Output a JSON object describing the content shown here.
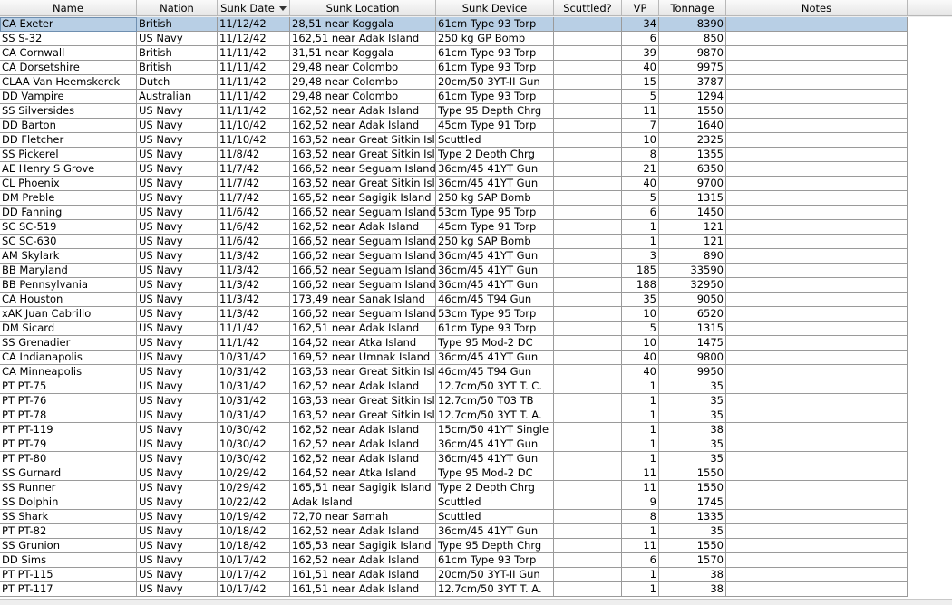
{
  "table": {
    "columns": [
      {
        "key": "name",
        "label": "Name"
      },
      {
        "key": "nation",
        "label": "Nation"
      },
      {
        "key": "date",
        "label": "Sunk Date",
        "sorted": "descending"
      },
      {
        "key": "location",
        "label": "Sunk Location"
      },
      {
        "key": "device",
        "label": "Sunk Device"
      },
      {
        "key": "scuttled",
        "label": "Scuttled?"
      },
      {
        "key": "vp",
        "label": "VP"
      },
      {
        "key": "tonnage",
        "label": "Tonnage"
      },
      {
        "key": "notes",
        "label": "Notes"
      }
    ],
    "selected_row": 0,
    "selection_color": "#b8cfe5",
    "sort_icon": "sort-descending-icon",
    "rows": [
      {
        "name": "CA Exeter",
        "nation": "British",
        "date": "11/12/42",
        "location": "28,51 near Koggala",
        "device": "61cm Type 93 Torp",
        "scuttled": "",
        "vp": "34",
        "tonnage": "8390",
        "notes": ""
      },
      {
        "name": "SS S-32",
        "nation": "US Navy",
        "date": "11/12/42",
        "location": "162,51 near Adak Island",
        "device": "250 kg GP Bomb",
        "scuttled": "",
        "vp": "6",
        "tonnage": "850",
        "notes": ""
      },
      {
        "name": "CA Cornwall",
        "nation": "British",
        "date": "11/11/42",
        "location": "31,51 near Koggala",
        "device": "61cm Type 93 Torp",
        "scuttled": "",
        "vp": "39",
        "tonnage": "9870",
        "notes": ""
      },
      {
        "name": "CA Dorsetshire",
        "nation": "British",
        "date": "11/11/42",
        "location": "29,48 near Colombo",
        "device": "61cm Type 93 Torp",
        "scuttled": "",
        "vp": "40",
        "tonnage": "9975",
        "notes": ""
      },
      {
        "name": "CLAA Van Heemskerck",
        "nation": "Dutch",
        "date": "11/11/42",
        "location": "29,48 near Colombo",
        "device": "20cm/50 3YT-II Gun",
        "scuttled": "",
        "vp": "15",
        "tonnage": "3787",
        "notes": ""
      },
      {
        "name": "DD Vampire",
        "nation": "Australian",
        "date": "11/11/42",
        "location": "29,48 near Colombo",
        "device": "61cm Type 93 Torp",
        "scuttled": "",
        "vp": "5",
        "tonnage": "1294",
        "notes": ""
      },
      {
        "name": "SS Silversides",
        "nation": "US Navy",
        "date": "11/11/42",
        "location": "162,52 near Adak Island",
        "device": "Type 95 Depth Chrg",
        "scuttled": "",
        "vp": "11",
        "tonnage": "1550",
        "notes": ""
      },
      {
        "name": "DD Barton",
        "nation": "US Navy",
        "date": "11/10/42",
        "location": "162,52 near Adak Island",
        "device": "45cm Type 91 Torp",
        "scuttled": "",
        "vp": "7",
        "tonnage": "1640",
        "notes": ""
      },
      {
        "name": "DD Fletcher",
        "nation": "US Navy",
        "date": "11/10/42",
        "location": "163,52 near Great Sitkin Isl...",
        "device": "Scuttled",
        "scuttled": "",
        "vp": "10",
        "tonnage": "2325",
        "notes": ""
      },
      {
        "name": "SS Pickerel",
        "nation": "US Navy",
        "date": "11/8/42",
        "location": "163,52 near Great Sitkin Isl...",
        "device": "Type 2 Depth Chrg",
        "scuttled": "",
        "vp": "8",
        "tonnage": "1355",
        "notes": ""
      },
      {
        "name": "AE Henry S Grove",
        "nation": "US Navy",
        "date": "11/7/42",
        "location": "166,52 near Seguam Island",
        "device": "36cm/45 41YT Gun",
        "scuttled": "",
        "vp": "21",
        "tonnage": "6350",
        "notes": ""
      },
      {
        "name": "CL Phoenix",
        "nation": "US Navy",
        "date": "11/7/42",
        "location": "163,52 near Great Sitkin Isl...",
        "device": "36cm/45 41YT Gun",
        "scuttled": "",
        "vp": "40",
        "tonnage": "9700",
        "notes": ""
      },
      {
        "name": "DM Preble",
        "nation": "US Navy",
        "date": "11/7/42",
        "location": "165,52 near Sagigik Island",
        "device": "250 kg SAP Bomb",
        "scuttled": "",
        "vp": "5",
        "tonnage": "1315",
        "notes": ""
      },
      {
        "name": "DD Fanning",
        "nation": "US Navy",
        "date": "11/6/42",
        "location": "166,52 near Seguam Island",
        "device": "53cm Type 95 Torp",
        "scuttled": "",
        "vp": "6",
        "tonnage": "1450",
        "notes": ""
      },
      {
        "name": "SC SC-519",
        "nation": "US Navy",
        "date": "11/6/42",
        "location": "162,52 near Adak Island",
        "device": "45cm Type 91 Torp",
        "scuttled": "",
        "vp": "1",
        "tonnage": "121",
        "notes": ""
      },
      {
        "name": "SC SC-630",
        "nation": "US Navy",
        "date": "11/6/42",
        "location": "166,52 near Seguam Island",
        "device": "250 kg SAP Bomb",
        "scuttled": "",
        "vp": "1",
        "tonnage": "121",
        "notes": ""
      },
      {
        "name": "AM Skylark",
        "nation": "US Navy",
        "date": "11/3/42",
        "location": "166,52 near Seguam Island",
        "device": "36cm/45 41YT Gun",
        "scuttled": "",
        "vp": "3",
        "tonnage": "890",
        "notes": ""
      },
      {
        "name": "BB Maryland",
        "nation": "US Navy",
        "date": "11/3/42",
        "location": "166,52 near Seguam Island",
        "device": "36cm/45 41YT Gun",
        "scuttled": "",
        "vp": "185",
        "tonnage": "33590",
        "notes": ""
      },
      {
        "name": "BB Pennsylvania",
        "nation": "US Navy",
        "date": "11/3/42",
        "location": "166,52 near Seguam Island",
        "device": "36cm/45 41YT Gun",
        "scuttled": "",
        "vp": "188",
        "tonnage": "32950",
        "notes": ""
      },
      {
        "name": "CA Houston",
        "nation": "US Navy",
        "date": "11/3/42",
        "location": "173,49 near Sanak Island",
        "device": "46cm/45 T94 Gun",
        "scuttled": "",
        "vp": "35",
        "tonnage": "9050",
        "notes": ""
      },
      {
        "name": "xAK Juan Cabrillo",
        "nation": "US Navy",
        "date": "11/3/42",
        "location": "166,52 near Seguam Island",
        "device": "53cm Type 95 Torp",
        "scuttled": "",
        "vp": "10",
        "tonnage": "6520",
        "notes": ""
      },
      {
        "name": "DM Sicard",
        "nation": "US Navy",
        "date": "11/1/42",
        "location": "162,51 near Adak Island",
        "device": "61cm Type 93 Torp",
        "scuttled": "",
        "vp": "5",
        "tonnage": "1315",
        "notes": ""
      },
      {
        "name": "SS Grenadier",
        "nation": "US Navy",
        "date": "11/1/42",
        "location": "164,52 near Atka Island",
        "device": "Type 95 Mod-2 DC",
        "scuttled": "",
        "vp": "10",
        "tonnage": "1475",
        "notes": ""
      },
      {
        "name": "CA Indianapolis",
        "nation": "US Navy",
        "date": "10/31/42",
        "location": "169,52 near Umnak Island",
        "device": "36cm/45 41YT Gun",
        "scuttled": "",
        "vp": "40",
        "tonnage": "9800",
        "notes": ""
      },
      {
        "name": "CA Minneapolis",
        "nation": "US Navy",
        "date": "10/31/42",
        "location": "163,53 near Great Sitkin Isl...",
        "device": "46cm/45 T94 Gun",
        "scuttled": "",
        "vp": "40",
        "tonnage": "9950",
        "notes": ""
      },
      {
        "name": "PT PT-75",
        "nation": "US Navy",
        "date": "10/31/42",
        "location": "162,52 near Adak Island",
        "device": "12.7cm/50 3YT T. C.",
        "scuttled": "",
        "vp": "1",
        "tonnage": "35",
        "notes": ""
      },
      {
        "name": "PT PT-76",
        "nation": "US Navy",
        "date": "10/31/42",
        "location": "163,53 near Great Sitkin Isl...",
        "device": "12.7cm/50 T03 TB",
        "scuttled": "",
        "vp": "1",
        "tonnage": "35",
        "notes": ""
      },
      {
        "name": "PT PT-78",
        "nation": "US Navy",
        "date": "10/31/42",
        "location": "163,52 near Great Sitkin Isl...",
        "device": "12.7cm/50 3YT T. A.",
        "scuttled": "",
        "vp": "1",
        "tonnage": "35",
        "notes": ""
      },
      {
        "name": "PT PT-119",
        "nation": "US Navy",
        "date": "10/30/42",
        "location": "162,52 near Adak Island",
        "device": "15cm/50 41YT Single",
        "scuttled": "",
        "vp": "1",
        "tonnage": "38",
        "notes": ""
      },
      {
        "name": "PT PT-79",
        "nation": "US Navy",
        "date": "10/30/42",
        "location": "162,52 near Adak Island",
        "device": "36cm/45 41YT Gun",
        "scuttled": "",
        "vp": "1",
        "tonnage": "35",
        "notes": ""
      },
      {
        "name": "PT PT-80",
        "nation": "US Navy",
        "date": "10/30/42",
        "location": "162,52 near Adak Island",
        "device": "36cm/45 41YT Gun",
        "scuttled": "",
        "vp": "1",
        "tonnage": "35",
        "notes": ""
      },
      {
        "name": "SS Gurnard",
        "nation": "US Navy",
        "date": "10/29/42",
        "location": "164,52 near Atka Island",
        "device": "Type 95 Mod-2 DC",
        "scuttled": "",
        "vp": "11",
        "tonnage": "1550",
        "notes": ""
      },
      {
        "name": "SS Runner",
        "nation": "US Navy",
        "date": "10/29/42",
        "location": "165,51 near Sagigik Island",
        "device": "Type 2 Depth Chrg",
        "scuttled": "",
        "vp": "11",
        "tonnage": "1550",
        "notes": ""
      },
      {
        "name": "SS Dolphin",
        "nation": "US Navy",
        "date": "10/22/42",
        "location": "Adak Island",
        "device": "Scuttled",
        "scuttled": "",
        "vp": "9",
        "tonnage": "1745",
        "notes": ""
      },
      {
        "name": "SS Shark",
        "nation": "US Navy",
        "date": "10/19/42",
        "location": "72,70 near Samah",
        "device": "Scuttled",
        "scuttled": "",
        "vp": "8",
        "tonnage": "1335",
        "notes": ""
      },
      {
        "name": "PT PT-82",
        "nation": "US Navy",
        "date": "10/18/42",
        "location": "162,52 near Adak Island",
        "device": "36cm/45 41YT Gun",
        "scuttled": "",
        "vp": "1",
        "tonnage": "35",
        "notes": ""
      },
      {
        "name": "SS Grunion",
        "nation": "US Navy",
        "date": "10/18/42",
        "location": "165,53 near Sagigik Island",
        "device": "Type 95 Depth Chrg",
        "scuttled": "",
        "vp": "11",
        "tonnage": "1550",
        "notes": ""
      },
      {
        "name": "DD Sims",
        "nation": "US Navy",
        "date": "10/17/42",
        "location": "162,52 near Adak Island",
        "device": "61cm Type 93 Torp",
        "scuttled": "",
        "vp": "6",
        "tonnage": "1570",
        "notes": ""
      },
      {
        "name": "PT PT-115",
        "nation": "US Navy",
        "date": "10/17/42",
        "location": "161,51 near Adak Island",
        "device": "20cm/50 3YT-II Gun",
        "scuttled": "",
        "vp": "1",
        "tonnage": "38",
        "notes": ""
      },
      {
        "name": "PT PT-117",
        "nation": "US Navy",
        "date": "10/17/42",
        "location": "161,51 near Adak Island",
        "device": "12.7cm/50 3YT T. A.",
        "scuttled": "",
        "vp": "1",
        "tonnage": "38",
        "notes": ""
      }
    ]
  }
}
